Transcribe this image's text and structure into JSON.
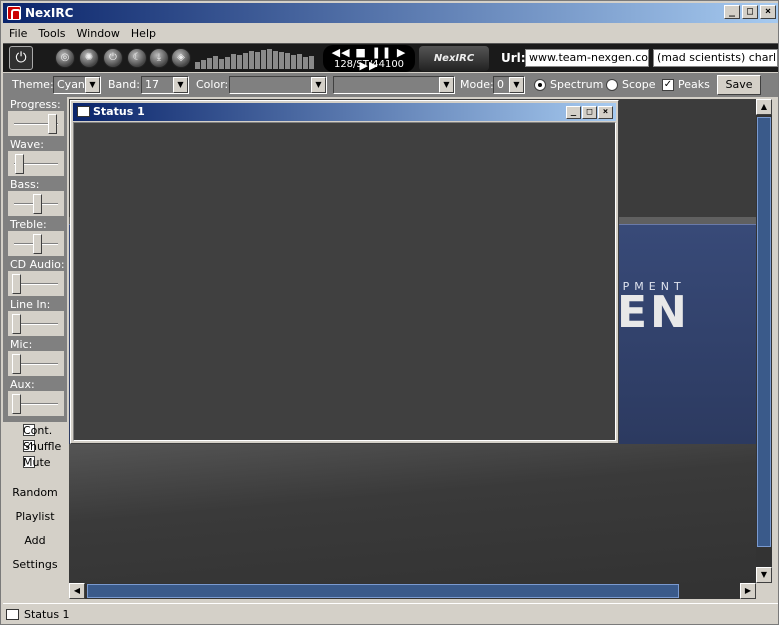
{
  "window": {
    "title": "NexIRC"
  },
  "title_buttons": {
    "minimize": "_",
    "maximize": "□",
    "close": "×"
  },
  "menu": [
    "File",
    "Tools",
    "Window",
    "Help"
  ],
  "player": {
    "transport_controls": "◀◀ ■ ❚❚ ▶ ▶▶",
    "format": "128/ST/44100",
    "logo": "NexIRC",
    "url_label": "Url:",
    "url_value": "www.team-nexgen.com",
    "topic_value": "(mad scientists) charlie.m",
    "spectrum_levels": [
      0.35,
      0.45,
      0.55,
      0.65,
      0.5,
      0.6,
      0.75,
      0.7,
      0.8,
      0.9,
      0.85,
      0.95,
      1.0,
      0.9,
      0.85,
      0.8,
      0.7,
      0.75,
      0.6,
      0.65
    ]
  },
  "options": {
    "theme_label": "Theme:",
    "theme_value": "Cyan",
    "band_label": "Band:",
    "band_value": "17",
    "color_label": "Color:",
    "color_value": "",
    "color2_value": "",
    "mode_label": "Mode:",
    "mode_value": "0",
    "spectrum_label": "Spectrum",
    "spectrum_selected": true,
    "scope_label": "Scope",
    "scope_selected": false,
    "peaks_label": "Peaks",
    "peaks_checked": true,
    "save_label": "Save"
  },
  "mixer": [
    {
      "label": "Progress:",
      "level": 0.9
    },
    {
      "label": "Wave:",
      "level": 0.12
    },
    {
      "label": "Bass:",
      "level": 0.55
    },
    {
      "label": "Treble:",
      "level": 0.55
    },
    {
      "label": "CD Audio:",
      "level": 0.05
    },
    {
      "label": "Line In:",
      "level": 0.05
    },
    {
      "label": "Mic:",
      "level": 0.05
    },
    {
      "label": "Aux:",
      "level": 0.05
    }
  ],
  "playback_options": [
    {
      "label": "Cont.",
      "checked": false
    },
    {
      "label": "Shuffle",
      "checked": true
    },
    {
      "label": "Mute",
      "checked": false
    }
  ],
  "commands": [
    "Random",
    "Playlist",
    "Add",
    "Settings"
  ],
  "background": {
    "tagline": "OPMENT",
    "logo_fragment": "EN"
  },
  "status_window": {
    "title": "Status 1"
  },
  "statusbar": {
    "tab_label": "Status 1"
  }
}
